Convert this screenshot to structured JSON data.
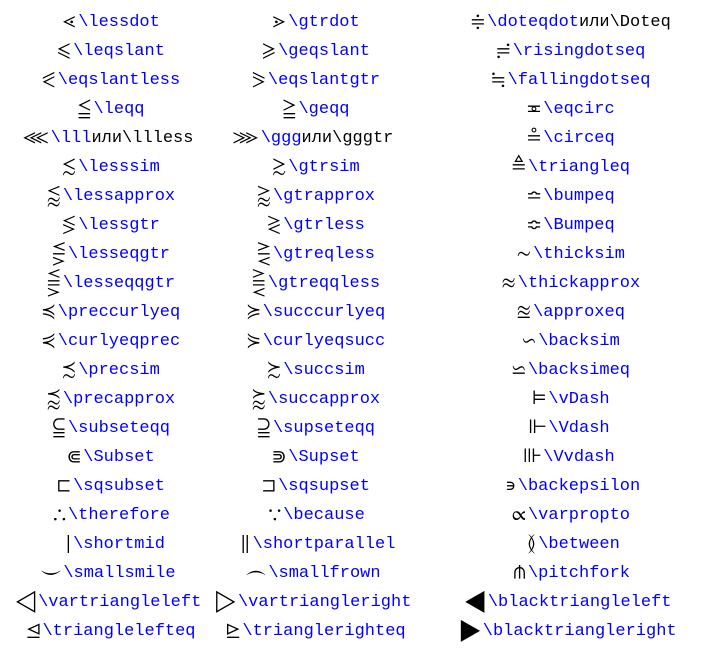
{
  "rows": [
    {
      "c1": {
        "sym": "⋖",
        "parts": [
          {
            "t": "cmd",
            "v": "\\lessdot"
          }
        ]
      },
      "c2": {
        "sym": "⋗",
        "parts": [
          {
            "t": "cmd",
            "v": "\\gtrdot"
          }
        ]
      },
      "c3": {
        "sym": "≑",
        "parts": [
          {
            "t": "cmd",
            "v": "\\doteqdot"
          },
          {
            "t": "plain",
            "v": " или "
          },
          {
            "t": "plain",
            "v": "\\Doteq"
          }
        ]
      }
    },
    {
      "c1": {
        "sym": "⩽",
        "parts": [
          {
            "t": "cmd",
            "v": "\\leqslant"
          }
        ]
      },
      "c2": {
        "sym": "⩾",
        "parts": [
          {
            "t": "cmd",
            "v": "\\geqslant"
          }
        ]
      },
      "c3": {
        "sym": "≓",
        "parts": [
          {
            "t": "cmd",
            "v": "\\risingdotseq"
          }
        ]
      }
    },
    {
      "c1": {
        "sym": "⪕",
        "parts": [
          {
            "t": "cmd",
            "v": "\\eqslantless"
          }
        ]
      },
      "c2": {
        "sym": "⪖",
        "parts": [
          {
            "t": "cmd",
            "v": "\\eqslantgtr"
          }
        ]
      },
      "c3": {
        "sym": "≒",
        "parts": [
          {
            "t": "cmd",
            "v": "\\fallingdotseq"
          }
        ]
      }
    },
    {
      "c1": {
        "sym": "≦",
        "parts": [
          {
            "t": "cmd",
            "v": "\\leqq"
          }
        ]
      },
      "c2": {
        "sym": "≧",
        "parts": [
          {
            "t": "cmd",
            "v": "\\geqq"
          }
        ]
      },
      "c3": {
        "sym": "≖",
        "parts": [
          {
            "t": "cmd",
            "v": "\\eqcirc"
          }
        ]
      }
    },
    {
      "c1": {
        "sym": "⋘",
        "parts": [
          {
            "t": "cmd",
            "v": "\\lll"
          },
          {
            "t": "plain",
            "v": " или "
          },
          {
            "t": "plain",
            "v": "\\llless"
          }
        ]
      },
      "c2": {
        "sym": "⋙",
        "parts": [
          {
            "t": "cmd",
            "v": "\\ggg"
          },
          {
            "t": "plain",
            "v": " или "
          },
          {
            "t": "plain",
            "v": "\\gggtr"
          }
        ]
      },
      "c3": {
        "sym": "≗",
        "parts": [
          {
            "t": "cmd",
            "v": "\\circeq"
          }
        ]
      }
    },
    {
      "c1": {
        "sym": "≲",
        "parts": [
          {
            "t": "cmd",
            "v": "\\lesssim"
          }
        ]
      },
      "c2": {
        "sym": "≳",
        "parts": [
          {
            "t": "cmd",
            "v": "\\gtrsim"
          }
        ]
      },
      "c3": {
        "sym": "≜",
        "parts": [
          {
            "t": "cmd",
            "v": "\\triangleq"
          }
        ]
      }
    },
    {
      "c1": {
        "sym": "⪅",
        "parts": [
          {
            "t": "cmd",
            "v": "\\lessapprox"
          }
        ]
      },
      "c2": {
        "sym": "⪆",
        "parts": [
          {
            "t": "cmd",
            "v": "\\gtrapprox"
          }
        ]
      },
      "c3": {
        "sym": "≏",
        "parts": [
          {
            "t": "cmd",
            "v": "\\bumpeq"
          }
        ]
      }
    },
    {
      "c1": {
        "sym": "≶",
        "parts": [
          {
            "t": "cmd",
            "v": "\\lessgtr"
          }
        ]
      },
      "c2": {
        "sym": "≷",
        "parts": [
          {
            "t": "cmd",
            "v": "\\gtrless"
          }
        ]
      },
      "c3": {
        "sym": "≎",
        "parts": [
          {
            "t": "cmd",
            "v": "\\Bumpeq"
          }
        ]
      }
    },
    {
      "c1": {
        "sym": "⋚",
        "parts": [
          {
            "t": "cmd",
            "v": "\\lesseqgtr"
          }
        ]
      },
      "c2": {
        "sym": "⋛",
        "parts": [
          {
            "t": "cmd",
            "v": "\\gtreqless"
          }
        ]
      },
      "c3": {
        "sym": "∼",
        "parts": [
          {
            "t": "cmd",
            "v": "\\thicksim"
          }
        ]
      }
    },
    {
      "c1": {
        "sym": "⪋",
        "parts": [
          {
            "t": "cmd",
            "v": "\\lesseqqgtr"
          }
        ]
      },
      "c2": {
        "sym": "⪌",
        "parts": [
          {
            "t": "cmd",
            "v": "\\gtreqqless"
          }
        ]
      },
      "c3": {
        "sym": "≈",
        "parts": [
          {
            "t": "cmd",
            "v": "\\thickapprox"
          }
        ]
      }
    },
    {
      "c1": {
        "sym": "≼",
        "parts": [
          {
            "t": "cmd",
            "v": "\\preccurlyeq"
          }
        ]
      },
      "c2": {
        "sym": "≽",
        "parts": [
          {
            "t": "cmd",
            "v": "\\succcurlyeq"
          }
        ]
      },
      "c3": {
        "sym": "≊",
        "parts": [
          {
            "t": "cmd",
            "v": "\\approxeq"
          }
        ]
      }
    },
    {
      "c1": {
        "sym": "⋞",
        "parts": [
          {
            "t": "cmd",
            "v": "\\curlyeqprec"
          }
        ]
      },
      "c2": {
        "sym": "⋟",
        "parts": [
          {
            "t": "cmd",
            "v": "\\curlyeqsucc"
          }
        ]
      },
      "c3": {
        "sym": "∽",
        "parts": [
          {
            "t": "cmd",
            "v": "\\backsim"
          }
        ]
      }
    },
    {
      "c1": {
        "sym": "≾",
        "parts": [
          {
            "t": "cmd",
            "v": "\\precsim"
          }
        ]
      },
      "c2": {
        "sym": "≿",
        "parts": [
          {
            "t": "cmd",
            "v": "\\succsim"
          }
        ]
      },
      "c3": {
        "sym": "⋍",
        "parts": [
          {
            "t": "cmd",
            "v": "\\backsimeq"
          }
        ]
      }
    },
    {
      "c1": {
        "sym": "⪷",
        "parts": [
          {
            "t": "cmd",
            "v": "\\precapprox"
          }
        ]
      },
      "c2": {
        "sym": "⪸",
        "parts": [
          {
            "t": "cmd",
            "v": "\\succapprox"
          }
        ]
      },
      "c3": {
        "sym": "⊨",
        "parts": [
          {
            "t": "cmd",
            "v": "\\vDash"
          }
        ]
      }
    },
    {
      "c1": {
        "sym": "⫅",
        "parts": [
          {
            "t": "cmd",
            "v": "\\subseteqq"
          }
        ]
      },
      "c2": {
        "sym": "⫆",
        "parts": [
          {
            "t": "cmd",
            "v": "\\supseteqq"
          }
        ]
      },
      "c3": {
        "sym": "⊩",
        "parts": [
          {
            "t": "cmd",
            "v": "\\Vdash"
          }
        ]
      }
    },
    {
      "c1": {
        "sym": "⋐",
        "parts": [
          {
            "t": "cmd",
            "v": "\\Subset"
          }
        ]
      },
      "c2": {
        "sym": "⋑",
        "parts": [
          {
            "t": "cmd",
            "v": "\\Supset"
          }
        ]
      },
      "c3": {
        "sym": "⊪",
        "parts": [
          {
            "t": "cmd",
            "v": "\\Vvdash"
          }
        ]
      }
    },
    {
      "c1": {
        "sym": "⊏",
        "parts": [
          {
            "t": "cmd",
            "v": "\\sqsubset"
          }
        ]
      },
      "c2": {
        "sym": "⊐",
        "parts": [
          {
            "t": "cmd",
            "v": "\\sqsupset"
          }
        ]
      },
      "c3": {
        "sym": "∍",
        "parts": [
          {
            "t": "cmd",
            "v": "\\backepsilon"
          }
        ]
      }
    },
    {
      "c1": {
        "sym": "∴",
        "parts": [
          {
            "t": "cmd",
            "v": "\\therefore"
          }
        ]
      },
      "c2": {
        "sym": "∵",
        "parts": [
          {
            "t": "cmd",
            "v": "\\because"
          }
        ]
      },
      "c3": {
        "sym": "∝",
        "parts": [
          {
            "t": "cmd",
            "v": "\\varpropto"
          }
        ]
      }
    },
    {
      "c1": {
        "sym": "∣",
        "parts": [
          {
            "t": "cmd",
            "v": "\\shortmid"
          }
        ]
      },
      "c2": {
        "sym": "∥",
        "parts": [
          {
            "t": "cmd",
            "v": "\\shortparallel"
          }
        ]
      },
      "c3": {
        "sym": "≬",
        "parts": [
          {
            "t": "cmd",
            "v": "\\between"
          }
        ]
      }
    },
    {
      "c1": {
        "sym": "⌣",
        "parts": [
          {
            "t": "cmd",
            "v": "\\smallsmile"
          }
        ]
      },
      "c2": {
        "sym": "⌢",
        "parts": [
          {
            "t": "cmd",
            "v": "\\smallfrown"
          }
        ]
      },
      "c3": {
        "sym": "⋔",
        "parts": [
          {
            "t": "cmd",
            "v": "\\pitchfork"
          }
        ]
      }
    },
    {
      "c1": {
        "sym": "◁",
        "parts": [
          {
            "t": "cmd",
            "v": "\\vartriangleleft"
          }
        ]
      },
      "c2": {
        "sym": "▷",
        "parts": [
          {
            "t": "cmd",
            "v": "\\vartriangleright"
          }
        ]
      },
      "c3": {
        "sym": "◀",
        "parts": [
          {
            "t": "cmd",
            "v": "\\blacktriangleleft"
          }
        ]
      }
    },
    {
      "c1": {
        "sym": "⊴",
        "parts": [
          {
            "t": "cmd",
            "v": "\\trianglelefteq"
          }
        ]
      },
      "c2": {
        "sym": "⊵",
        "parts": [
          {
            "t": "cmd",
            "v": "\\trianglerighteq"
          }
        ]
      },
      "c3": {
        "sym": "▶",
        "parts": [
          {
            "t": "cmd",
            "v": "\\blacktriangleright"
          }
        ]
      }
    }
  ]
}
